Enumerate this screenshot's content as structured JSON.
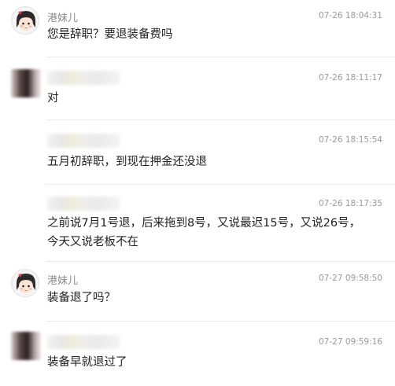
{
  "messages": [
    {
      "sender": "港妹儿",
      "time": "07-26 18:04:31",
      "text": "您是辞职？要退装备费吗",
      "avatar": "girl-avatar-icon"
    },
    {
      "sender": "",
      "time": "07-26 18:11:17",
      "text": "对",
      "avatar": "blurred-avatar"
    },
    {
      "sender": "",
      "time": "07-26 18:15:54",
      "text": "五月初辞职，到现在押金还没退",
      "avatar": ""
    },
    {
      "sender": "",
      "time": "07-26 18:17:35",
      "text": "之前说7月1号退，后来拖到8号，又说最迟15号，又说26号，今天又说老板不在",
      "avatar": ""
    },
    {
      "sender": "港妹儿",
      "time": "07-27 09:58:50",
      "text": "装备退了吗？",
      "avatar": "girl-avatar-icon"
    },
    {
      "sender": "",
      "time": "07-27 09:59:16",
      "text": "装备早就退过了",
      "avatar": "blurred-avatar"
    }
  ]
}
